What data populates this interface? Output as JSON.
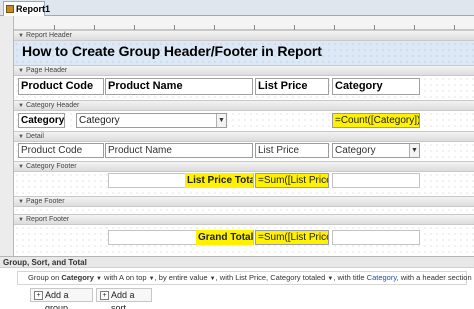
{
  "tab": {
    "label": "Report1"
  },
  "sections": {
    "report_header": "Report Header",
    "page_header": "Page Header",
    "category_header": "Category Header",
    "detail": "Detail",
    "category_footer": "Category Footer",
    "page_footer": "Page Footer",
    "report_footer": "Report Footer"
  },
  "report_title": "How to Create Group Header/Footer in Report",
  "page_header_labels": {
    "product_code": "Product Code",
    "product_name": "Product Name",
    "list_price": "List Price",
    "category": "Category"
  },
  "category_header": {
    "label": "Category",
    "combo_value": "Category",
    "count_expr": "=Count([Category])"
  },
  "detail": {
    "product_code": "Product Code",
    "product_name": "Product Name",
    "list_price": "List Price",
    "category": "Category"
  },
  "category_footer": {
    "label": "List Price Total:",
    "expr": "=Sum([List Price]"
  },
  "report_footer": {
    "label": "Grand Total:",
    "expr": "=Sum([List Price]"
  },
  "group_pane": {
    "title": "Group, Sort, and Total",
    "rule": {
      "group_on": "Group on",
      "field": "Category",
      "order": "with A on top",
      "by": "by entire value",
      "totals": "with List Price, Category totaled",
      "title_prefix": "with title",
      "title_value": "Category",
      "header": "with a header section"
    },
    "add_group": "Add a group",
    "add_sort": "Add a sort"
  },
  "colors": {
    "highlight": "#fff200",
    "report_header_band": "#dce8f5",
    "link_blue": "#1f4eb4"
  }
}
